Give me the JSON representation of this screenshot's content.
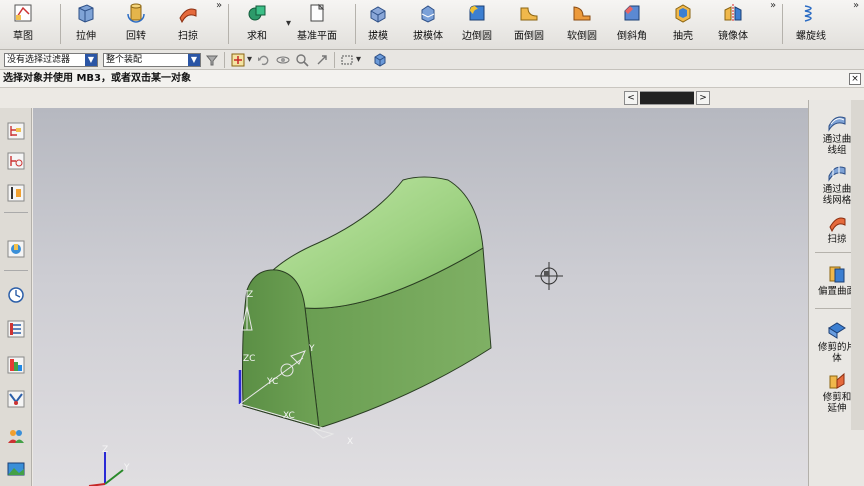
{
  "ribbon": {
    "items": [
      {
        "label": "草图",
        "icon": "sketch-icon"
      },
      {
        "label": "拉伸",
        "icon": "extrude-icon"
      },
      {
        "label": "回转",
        "icon": "revolve-icon"
      },
      {
        "label": "扫掠",
        "icon": "sweep-icon"
      },
      {
        "label": "求和",
        "icon": "unite-icon"
      },
      {
        "label": "基准平面",
        "icon": "datum-plane-icon"
      },
      {
        "label": "拔模",
        "icon": "draft-icon"
      },
      {
        "label": "拔模体",
        "icon": "draft-body-icon"
      },
      {
        "label": "边倒圆",
        "icon": "edge-blend-icon"
      },
      {
        "label": "面倒圆",
        "icon": "face-blend-icon"
      },
      {
        "label": "软倒圆",
        "icon": "soft-blend-icon"
      },
      {
        "label": "倒斜角",
        "icon": "chamfer-icon"
      },
      {
        "label": "抽壳",
        "icon": "shell-icon"
      },
      {
        "label": "镜像体",
        "icon": "mirror-body-icon"
      },
      {
        "label": "螺旋线",
        "icon": "helix-icon"
      }
    ],
    "more_glyph": "»"
  },
  "toolbar2": {
    "filter_value": "没有选择过滤器",
    "scope_value": "整个装配",
    "arrow_glyph": "▼"
  },
  "status": {
    "prompt": "选择对象并使用 MB3，或者双击某一对象",
    "close_glyph": "×"
  },
  "strip": {
    "prev_glyph": "<",
    "next_glyph": ">"
  },
  "right_panel": {
    "items": [
      {
        "label": "通过曲线组",
        "icon": "through-curves-icon"
      },
      {
        "label": "通过曲线网格",
        "icon": "through-curve-mesh-icon"
      },
      {
        "label": "扫掠",
        "icon": "sweep-surface-icon"
      },
      {
        "label": "偏置曲面",
        "icon": "offset-surface-icon"
      },
      {
        "label": "修剪的片体",
        "icon": "trimmed-sheet-icon"
      },
      {
        "label": "修剪和延伸",
        "icon": "trim-extend-icon"
      }
    ]
  },
  "viewport": {
    "wcs_labels": {
      "z": "Z",
      "zc": "ZC",
      "yc": "YC",
      "xc": "XC",
      "y": "Y",
      "x": "X"
    },
    "abs_labels": {
      "z": "Z",
      "y": "Y",
      "x": "X"
    },
    "colors": {
      "body_face": "#76a85c",
      "body_top": "#a8d890",
      "background": "#c8c9cf"
    }
  }
}
